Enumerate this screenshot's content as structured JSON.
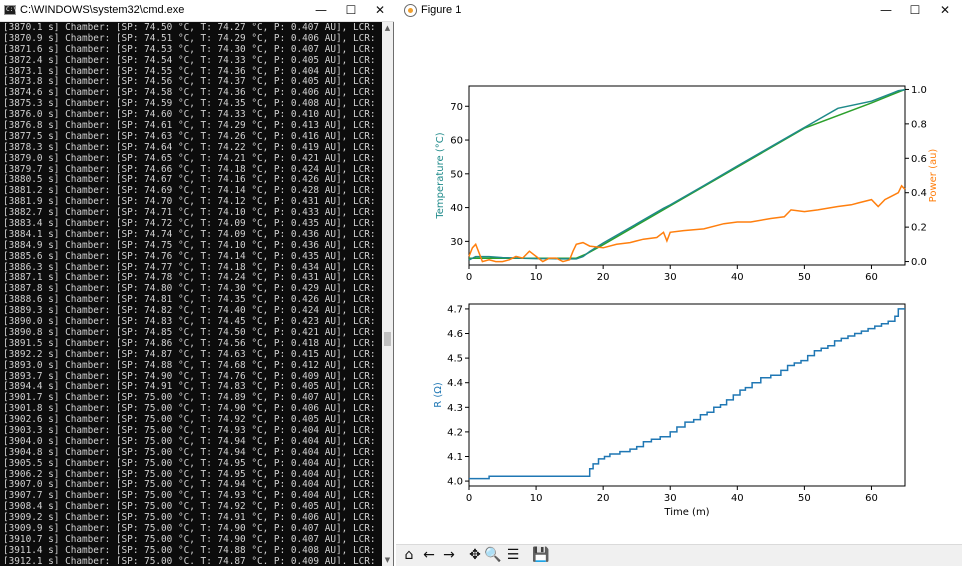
{
  "cmd_window": {
    "title": "C:\\WINDOWS\\system32\\cmd.exe",
    "icon": "C:\\",
    "controls": {
      "minimize": "—",
      "maximize": "☐",
      "close": "✕"
    },
    "lines": [
      "[3870.1 s] Chamber: [SP: 74.50 °C, T: 74.27 °C, P: 0.407 AU], LCR: [R: 4.700 Ω]",
      "[3870.9 s] Chamber: [SP: 74.51 °C, T: 74.29 °C, P: 0.406 AU], LCR: [R: 4.700 Ω]",
      "[3871.6 s] Chamber: [SP: 74.53 °C, T: 74.30 °C, P: 0.407 AU], LCR: [R: 4.700 Ω]",
      "[3872.4 s] Chamber: [SP: 74.54 °C, T: 74.33 °C, P: 0.405 AU], LCR: [R: 4.700 Ω]",
      "[3873.1 s] Chamber: [SP: 74.55 °C, T: 74.36 °C, P: 0.404 AU], LCR: [R: 4.700 Ω]",
      "[3873.8 s] Chamber: [SP: 74.56 °C, T: 74.37 °C, P: 0.405 AU], LCR: [R: 4.700 Ω]",
      "[3874.6 s] Chamber: [SP: 74.58 °C, T: 74.36 °C, P: 0.406 AU], LCR: [R: 4.700 Ω]",
      "[3875.3 s] Chamber: [SP: 74.59 °C, T: 74.35 °C, P: 0.408 AU], LCR: [R: 4.700 Ω]",
      "[3876.0 s] Chamber: [SP: 74.60 °C, T: 74.33 °C, P: 0.410 AU], LCR: [R: 4.700 Ω]",
      "[3876.8 s] Chamber: [SP: 74.61 °C, T: 74.29 °C, P: 0.413 AU], LCR: [R: 4.700 Ω]",
      "[3877.5 s] Chamber: [SP: 74.63 °C, T: 74.26 °C, P: 0.416 AU], LCR: [R: 4.700 Ω]",
      "[3878.3 s] Chamber: [SP: 74.64 °C, T: 74.22 °C, P: 0.419 AU], LCR: [R: 4.700 Ω]",
      "[3879.0 s] Chamber: [SP: 74.65 °C, T: 74.21 °C, P: 0.421 AU], LCR: [R: 4.700 Ω]",
      "[3879.7 s] Chamber: [SP: 74.66 °C, T: 74.18 °C, P: 0.424 AU], LCR: [R: 4.700 Ω]",
      "[3880.5 s] Chamber: [SP: 74.67 °C, T: 74.16 °C, P: 0.426 AU], LCR: [R: 4.700 Ω]",
      "[3881.2 s] Chamber: [SP: 74.69 °C, T: 74.14 °C, P: 0.428 AU], LCR: [R: 4.700 Ω]",
      "[3881.9 s] Chamber: [SP: 74.70 °C, T: 74.12 °C, P: 0.431 AU], LCR: [R: 4.700 Ω]",
      "[3882.7 s] Chamber: [SP: 74.71 °C, T: 74.10 °C, P: 0.433 AU], LCR: [R: 4.700 Ω]",
      "[3883.4 s] Chamber: [SP: 74.72 °C, T: 74.09 °C, P: 0.435 AU], LCR: [R: 4.700 Ω]",
      "[3884.1 s] Chamber: [SP: 74.74 °C, T: 74.09 °C, P: 0.436 AU], LCR: [R: 4.700 Ω]",
      "[3884.9 s] Chamber: [SP: 74.75 °C, T: 74.10 °C, P: 0.436 AU], LCR: [R: 4.700 Ω]",
      "[3885.6 s] Chamber: [SP: 74.76 °C, T: 74.14 °C, P: 0.435 AU], LCR: [R: 4.700 Ω]",
      "[3886.3 s] Chamber: [SP: 74.77 °C, T: 74.18 °C, P: 0.434 AU], LCR: [R: 4.700 Ω]",
      "[3887.1 s] Chamber: [SP: 74.78 °C, T: 74.24 °C, P: 0.431 AU], LCR: [R: 4.700 Ω]",
      "[3887.8 s] Chamber: [SP: 74.80 °C, T: 74.30 °C, P: 0.429 AU], LCR: [R: 4.700 Ω]",
      "[3888.6 s] Chamber: [SP: 74.81 °C, T: 74.35 °C, P: 0.426 AU], LCR: [R: 4.700 Ω]",
      "[3889.3 s] Chamber: [SP: 74.82 °C, T: 74.40 °C, P: 0.424 AU], LCR: [R: 4.700 Ω]",
      "[3890.0 s] Chamber: [SP: 74.83 °C, T: 74.45 °C, P: 0.423 AU], LCR: [R: 4.700 Ω]",
      "[3890.8 s] Chamber: [SP: 74.85 °C, T: 74.50 °C, P: 0.421 AU], LCR: [R: 4.700 Ω]",
      "[3891.5 s] Chamber: [SP: 74.86 °C, T: 74.56 °C, P: 0.418 AU], LCR: [R: 4.700 Ω]",
      "[3892.2 s] Chamber: [SP: 74.87 °C, T: 74.63 °C, P: 0.415 AU], LCR: [R: 4.700 Ω]",
      "[3893.0 s] Chamber: [SP: 74.88 °C, T: 74.68 °C, P: 0.412 AU], LCR: [R: 4.700 Ω]",
      "[3893.7 s] Chamber: [SP: 74.90 °C, T: 74.76 °C, P: 0.409 AU], LCR: [R: 4.700 Ω]",
      "[3894.4 s] Chamber: [SP: 74.91 °C, T: 74.83 °C, P: 0.405 AU], LCR: [R: 4.700 Ω]",
      "[3901.7 s] Chamber: [SP: 75.00 °C, T: 74.89 °C, P: 0.407 AU], LCR: [R: 4.700 Ω]",
      "[3901.8 s] Chamber: [SP: 75.00 °C, T: 74.90 °C, P: 0.406 AU], LCR: [R: 4.700 Ω]",
      "[3902.6 s] Chamber: [SP: 75.00 °C, T: 74.92 °C, P: 0.405 AU], LCR: [R: 4.700 Ω]",
      "[3903.3 s] Chamber: [SP: 75.00 °C, T: 74.93 °C, P: 0.404 AU], LCR: [R: 4.700 Ω]",
      "[3904.0 s] Chamber: [SP: 75.00 °C, T: 74.94 °C, P: 0.404 AU], LCR: [R: 4.700 Ω]",
      "[3904.8 s] Chamber: [SP: 75.00 °C, T: 74.94 °C, P: 0.404 AU], LCR: [R: 4.700 Ω]",
      "[3905.5 s] Chamber: [SP: 75.00 °C, T: 74.95 °C, P: 0.404 AU], LCR: [R: 4.700 Ω]",
      "[3906.2 s] Chamber: [SP: 75.00 °C, T: 74.95 °C, P: 0.404 AU], LCR: [R: 4.700 Ω]",
      "[3907.0 s] Chamber: [SP: 75.00 °C, T: 74.94 °C, P: 0.404 AU], LCR: [R: 4.700 Ω]",
      "[3907.7 s] Chamber: [SP: 75.00 °C, T: 74.93 °C, P: 0.404 AU], LCR: [R: 4.700 Ω]",
      "[3908.4 s] Chamber: [SP: 75.00 °C, T: 74.92 °C, P: 0.405 AU], LCR: [R: 4.700 Ω]",
      "[3909.2 s] Chamber: [SP: 75.00 °C, T: 74.91 °C, P: 0.406 AU], LCR: [R: 4.700 Ω]",
      "[3909.9 s] Chamber: [SP: 75.00 °C, T: 74.90 °C, P: 0.407 AU], LCR: [R: 4.700 Ω]",
      "[3910.7 s] Chamber: [SP: 75.00 °C, T: 74.90 °C, P: 0.407 AU], LCR: [R: 4.700 Ω]",
      "[3911.4 s] Chamber: [SP: 75.00 °C, T: 74.88 °C, P: 0.408 AU], LCR: [R: 4.710 Ω]",
      "[3912.1 s] Chamber: [SP: 75.00 °C, T: 74.87 °C, P: 0.409 AU], LCR: [R: 4.710 Ω]",
      "[3912.9 s] Chamber: [SP: 75.00 °C, T: 74.87 °C, P: 0.409 AU], LCR: [R: 4.710 Ω]"
    ]
  },
  "figure_window": {
    "title": "Figure 1",
    "controls": {
      "minimize": "—",
      "maximize": "☐",
      "close": "✕"
    },
    "toolbar": [
      {
        "name": "home-icon",
        "glyph": "⌂"
      },
      {
        "name": "back-arrow-icon",
        "glyph": "←"
      },
      {
        "name": "forward-arrow-icon",
        "glyph": "→"
      },
      {
        "name": "pan-icon",
        "glyph": "✥"
      },
      {
        "name": "zoom-icon",
        "glyph": "🔍"
      },
      {
        "name": "configure-subplots-icon",
        "glyph": "☰"
      },
      {
        "name": "save-icon",
        "glyph": "💾"
      }
    ]
  },
  "colors": {
    "temperature": "#1f8a8a",
    "power": "#ff7f0e",
    "resistance": "#1f77b4",
    "setpoint": "#2ca02c"
  },
  "chart_data": [
    {
      "type": "line",
      "xlim": [
        0,
        65
      ],
      "ylim": [
        23,
        76
      ],
      "ylim_right": [
        -0.02,
        1.02
      ],
      "xticks": [
        0,
        10,
        20,
        30,
        40,
        50,
        60
      ],
      "yticks": [
        30,
        40,
        50,
        60,
        70
      ],
      "yticks_right": [
        0.0,
        0.2,
        0.4,
        0.6,
        0.8,
        1.0
      ],
      "ylabel": "Temperature (°C)",
      "ylabel_right": "Power (au)",
      "xlabel": "",
      "series": [
        {
          "axis": "left",
          "x": [
            0,
            1,
            3,
            5,
            8,
            10,
            12,
            14,
            15,
            16,
            17,
            18,
            20,
            25,
            29,
            30,
            35,
            40,
            45,
            50,
            55,
            60,
            63,
            64,
            65
          ],
          "values": [
            24.5,
            25.5,
            25.5,
            25.2,
            25.0,
            24.9,
            24.9,
            24.8,
            24.8,
            24.8,
            25.5,
            27.0,
            29.5,
            35.2,
            39.8,
            40.8,
            46.5,
            52.3,
            58.0,
            63.7,
            69.4,
            71.5,
            73.8,
            74.6,
            74.9
          ]
        },
        {
          "axis": "left",
          "x": [
            0,
            1,
            10,
            15,
            16,
            17.5,
            20,
            30,
            40,
            50,
            60,
            65
          ],
          "values": [
            25.0,
            25.0,
            25.0,
            25.0,
            25.0,
            26.3,
            29.0,
            40.5,
            52.0,
            63.5,
            71.0,
            75.0
          ]
        },
        {
          "axis": "right",
          "x": [
            0,
            0.5,
            1,
            1.5,
            2,
            3,
            4,
            5,
            6,
            7,
            8,
            9,
            10,
            11,
            12,
            13,
            14,
            15,
            15.5,
            16,
            17,
            18,
            20,
            22,
            24,
            26,
            28,
            29,
            29.5,
            30,
            32,
            35,
            38,
            40,
            42,
            45,
            47,
            48,
            50,
            52,
            55,
            57,
            58,
            60,
            61,
            62,
            63,
            64,
            64.5,
            65
          ],
          "values": [
            0.03,
            0.08,
            0.1,
            0.05,
            0.0,
            0.01,
            0.0,
            0.0,
            0.01,
            0.03,
            0.02,
            0.06,
            0.03,
            0.0,
            0.02,
            0.02,
            0.0,
            0.01,
            0.06,
            0.1,
            0.11,
            0.09,
            0.08,
            0.1,
            0.11,
            0.13,
            0.14,
            0.17,
            0.12,
            0.17,
            0.18,
            0.19,
            0.22,
            0.23,
            0.23,
            0.25,
            0.26,
            0.3,
            0.29,
            0.3,
            0.32,
            0.33,
            0.34,
            0.36,
            0.32,
            0.36,
            0.38,
            0.4,
            0.44,
            0.42
          ]
        }
      ]
    },
    {
      "type": "line",
      "xlim": [
        0,
        65
      ],
      "ylim": [
        3.98,
        4.72
      ],
      "xticks": [
        0,
        10,
        20,
        30,
        40,
        50,
        60
      ],
      "yticks": [
        4.0,
        4.1,
        4.2,
        4.3,
        4.4,
        4.5,
        4.6,
        4.7
      ],
      "ylabel": "R (Ω)",
      "xlabel": "Time (m)",
      "series": [
        {
          "step": true,
          "x": [
            0,
            2.7,
            3,
            17.6,
            18,
            18.5,
            19.3,
            20.2,
            21,
            22.5,
            24,
            25,
            26,
            27.2,
            28.5,
            30,
            31,
            32.2,
            33.5,
            34.5,
            35.5,
            36.5,
            37.5,
            38.4,
            39.4,
            40.4,
            41.2,
            42.2,
            43.5,
            45,
            46.5,
            47.5,
            48.5,
            49.5,
            50.5,
            51.5,
            52.5,
            53.5,
            54.5,
            55.5,
            56.5,
            57.5,
            58.5,
            59.5,
            60.5,
            61.5,
            62.5,
            63.5,
            64,
            65
          ],
          "values": [
            4.01,
            4.01,
            4.02,
            4.02,
            4.05,
            4.07,
            4.09,
            4.1,
            4.11,
            4.12,
            4.13,
            4.14,
            4.16,
            4.17,
            4.18,
            4.2,
            4.22,
            4.24,
            4.25,
            4.27,
            4.28,
            4.3,
            4.31,
            4.33,
            4.35,
            4.37,
            4.38,
            4.4,
            4.42,
            4.43,
            4.45,
            4.47,
            4.48,
            4.49,
            4.51,
            4.53,
            4.54,
            4.55,
            4.57,
            4.58,
            4.59,
            4.6,
            4.61,
            4.62,
            4.63,
            4.64,
            4.65,
            4.67,
            4.7,
            4.7
          ]
        }
      ]
    }
  ]
}
